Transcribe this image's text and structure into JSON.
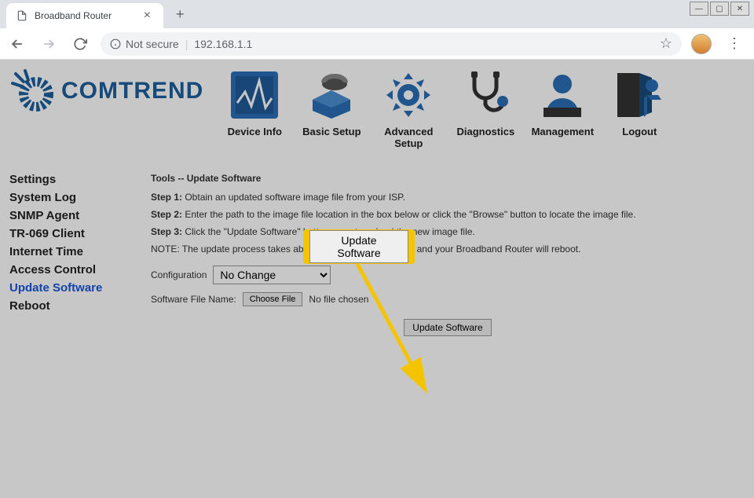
{
  "browser": {
    "tab_title": "Broadband Router",
    "not_secure": "Not secure",
    "url": "192.168.1.1"
  },
  "brand": "COMTREND",
  "topnav": [
    {
      "label": "Device Info"
    },
    {
      "label": "Basic Setup"
    },
    {
      "label": "Advanced Setup"
    },
    {
      "label": "Diagnostics"
    },
    {
      "label": "Management"
    },
    {
      "label": "Logout"
    }
  ],
  "sidebar": [
    {
      "label": "Settings",
      "active": false
    },
    {
      "label": "System Log",
      "active": false
    },
    {
      "label": "SNMP Agent",
      "active": false
    },
    {
      "label": "TR-069 Client",
      "active": false
    },
    {
      "label": "Internet Time",
      "active": false
    },
    {
      "label": "Access Control",
      "active": false
    },
    {
      "label": "Update Software",
      "active": true
    },
    {
      "label": "Reboot",
      "active": false
    }
  ],
  "content": {
    "heading": "Tools -- Update Software",
    "step1_label": "Step 1:",
    "step1_text": " Obtain an updated software image file from your ISP.",
    "step2_label": "Step 2:",
    "step2_text": " Enter the path to the image file location in the box below or click the \"Browse\" button to locate the image file.",
    "step3_label": "Step 3:",
    "step3_text": " Click the \"Update Software\" button once to upload the new image file.",
    "note": "NOTE: The update process takes about 2 minutes to complete, and your Broadband Router will reboot.",
    "config_label": "Configuration",
    "config_value": "No Change",
    "file_label": "Software File Name:",
    "choose_file": "Choose File",
    "no_file": "No file chosen",
    "update_btn": "Update Software"
  },
  "annotation": {
    "highlight_label": "Update Software"
  }
}
